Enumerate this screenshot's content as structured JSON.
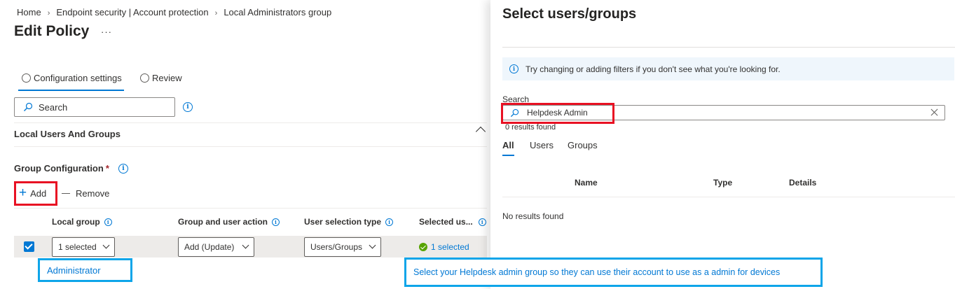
{
  "breadcrumb": {
    "items": [
      "Home",
      "Endpoint security | Account protection",
      "Local Administrators group"
    ]
  },
  "page": {
    "title": "Edit Policy",
    "more": "···"
  },
  "tabs": [
    {
      "label": "Configuration settings",
      "active": true
    },
    {
      "label": "Review",
      "active": false
    }
  ],
  "search": {
    "placeholder": "Search"
  },
  "section": {
    "title": "Local Users And Groups",
    "group_config_label": "Group Configuration",
    "required_mark": "*"
  },
  "toolbar": {
    "add_label": "Add",
    "remove_label": "Remove"
  },
  "table": {
    "columns": [
      "Local group",
      "Group and user action",
      "User selection type",
      "Selected us..."
    ],
    "row": {
      "local_group": "1 selected",
      "action": "Add (Update)",
      "selection_type": "Users/Groups",
      "selected": "1 selected"
    }
  },
  "annotations": {
    "administrator": "Administrator",
    "note": "Select your Helpdesk admin group so they can use their account to use as a admin for devices"
  },
  "panel": {
    "title": "Select users/groups",
    "banner": "Try changing or adding filters if you don't see what you're looking for.",
    "search_label": "Search",
    "search_value": "Helpdesk Admin",
    "results_count": "0 results found",
    "tabs": [
      "All",
      "Users",
      "Groups"
    ],
    "columns": [
      "Name",
      "Type",
      "Details"
    ],
    "empty": "No results found"
  },
  "colors": {
    "accent": "#0078d4",
    "highlight_red": "#e81123",
    "highlight_blue": "#0ea5e9",
    "success": "#57a300"
  }
}
